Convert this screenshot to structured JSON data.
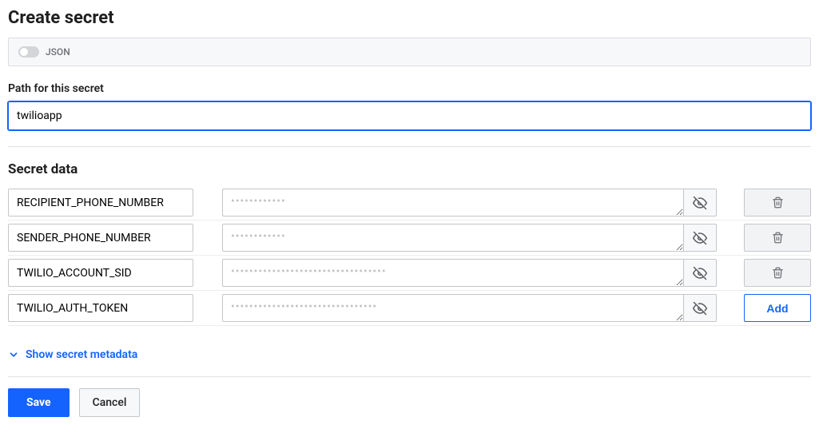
{
  "title": "Create secret",
  "json_toggle": {
    "label": "JSON",
    "on": false
  },
  "path": {
    "label": "Path for this secret",
    "value": "twilioapp"
  },
  "secret_data": {
    "title": "Secret data",
    "rows": [
      {
        "key": "RECIPIENT_PHONE_NUMBER",
        "value_mask": "••••••••••••"
      },
      {
        "key": "SENDER_PHONE_NUMBER",
        "value_mask": "••••••••••••"
      },
      {
        "key": "TWILIO_ACCOUNT_SID",
        "value_mask": "••••••••••••••••••••••••••••••••••"
      },
      {
        "key": "TWILIO_AUTH_TOKEN",
        "value_mask": "••••••••••••••••••••••••••••••••"
      }
    ],
    "add_label": "Add"
  },
  "metadata": {
    "toggle_label": "Show secret metadata"
  },
  "actions": {
    "save": "Save",
    "cancel": "Cancel"
  }
}
